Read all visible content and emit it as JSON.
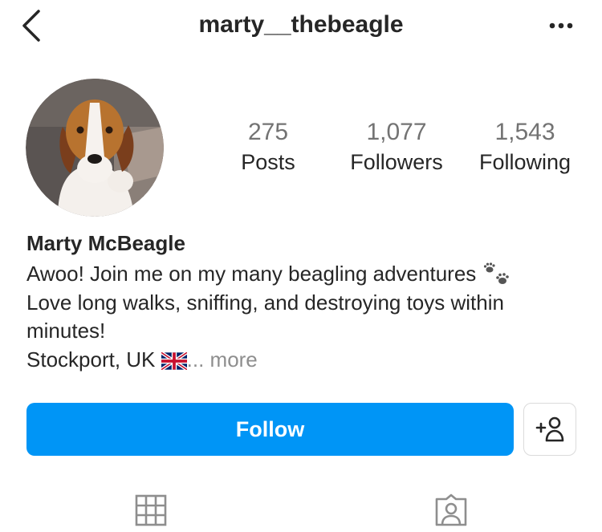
{
  "header": {
    "username": "marty__thebeagle",
    "back_icon": "chevron-left-icon",
    "more_icon": "more-horizontal-icon"
  },
  "profile": {
    "avatar": "beagle-avatar",
    "stats": [
      {
        "value": "275",
        "label": "Posts"
      },
      {
        "value": "1,077",
        "label": "Followers"
      },
      {
        "value": "1,543",
        "label": "Following"
      }
    ],
    "name": "Marty McBeagle",
    "bio": {
      "line1": "Awoo! Join me on my many beagling adventures",
      "line2": "Love long walks, sniffing, and destroying toys within",
      "line3": "minutes!",
      "line4": "Stockport, UK",
      "more": "... more"
    }
  },
  "actions": {
    "follow_label": "Follow",
    "add_user_icon": "add-user-icon",
    "accent_color": "#0095f6"
  },
  "tabs": [
    {
      "icon": "grid-icon"
    },
    {
      "icon": "tagged-icon"
    }
  ]
}
